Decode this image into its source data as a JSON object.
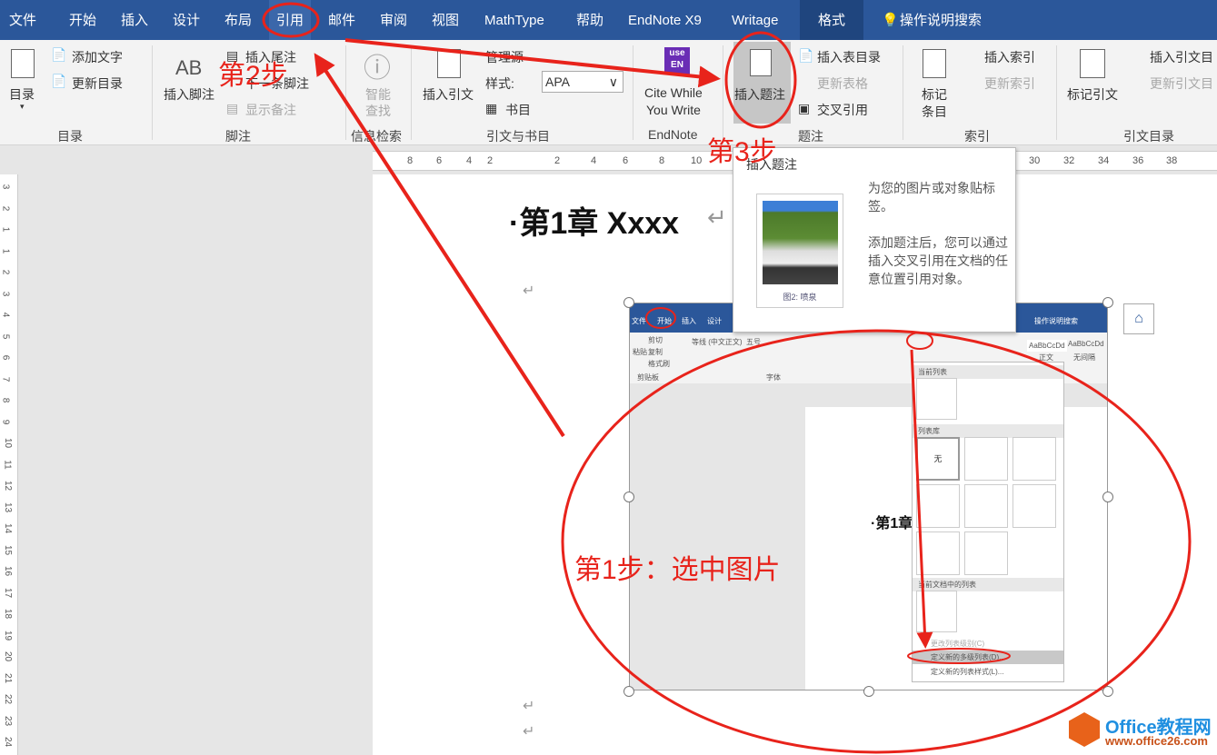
{
  "tabs": [
    "文件",
    "开始",
    "插入",
    "设计",
    "布局",
    "引用",
    "邮件",
    "审阅",
    "视图",
    "MathType",
    "帮助",
    "EndNote X9",
    "Writage",
    "格式"
  ],
  "search_label": "操作说明搜索",
  "ribbon": {
    "toc": {
      "main": "目录",
      "add_text": "添加文字",
      "update": "更新目录",
      "group": "目录"
    },
    "footnote": {
      "insert_footnote": "插入脚注",
      "insert_endnote": "插入尾注",
      "next_footnote": "下一条脚注",
      "show_notes": "显示备注",
      "group": "脚注",
      "ab": "AB"
    },
    "research": {
      "smart_lookup_1": "智能",
      "smart_lookup_2": "查找",
      "group": "信息检索"
    },
    "citations": {
      "insert_citation": "插入引文",
      "manage_sources": "管理源",
      "style_label": "样式:",
      "style_value": "APA",
      "bibliography": "书目",
      "group": "引文与书目"
    },
    "endnote": {
      "cite_1": "Cite While",
      "cite_2": "You Write",
      "group": "EndNote",
      "logo_1": "use",
      "logo_2": "EN"
    },
    "captions": {
      "insert_caption": "插入题注",
      "insert_tof": "插入表目录",
      "update_table": "更新表格",
      "cross_ref": "交叉引用",
      "group": "题注"
    },
    "index": {
      "mark_entry_1": "标记",
      "mark_entry_2": "条目",
      "insert_index": "插入索引",
      "update_index": "更新索引",
      "group": "索引"
    },
    "toa": {
      "mark_citation": "标记引文",
      "insert_toa": "插入引文目",
      "update_toa": "更新引文目",
      "group": "引文目录"
    }
  },
  "ruler": [
    "8",
    "6",
    "4",
    "2",
    "2",
    "4",
    "6",
    "8",
    "10",
    "30",
    "32",
    "34",
    "36",
    "38"
  ],
  "vruler": [
    "3",
    "2",
    "1",
    "1",
    "2",
    "3",
    "4",
    "5",
    "6",
    "7",
    "8",
    "9",
    "10",
    "11",
    "12",
    "13",
    "14",
    "15",
    "16",
    "17",
    "18",
    "19",
    "20",
    "21",
    "22",
    "23",
    "24"
  ],
  "document": {
    "heading": "·第1章 Xxxx",
    "return_mark": "↵"
  },
  "tooltip": {
    "title": "插入题注",
    "desc1": "为您的图片或对象贴标签。",
    "desc2": "添加题注后，您可以通过插入交叉引用在文档的任意位置引用对象。",
    "caption": "图2: 喷泉"
  },
  "inner": {
    "tabs": [
      "文件",
      "开始",
      "插入",
      "设计"
    ],
    "search": "操作说明搜索",
    "cut": "剪切",
    "copy": "复制",
    "painter": "格式刷",
    "paste": "粘贴",
    "clipboard": "剪贴板",
    "font": "等线 (中文正文)",
    "size": "五号",
    "font_group": "字体",
    "style1": "AaBbCcDd",
    "style1_label": "正文",
    "style2": "AaBbCcDd",
    "style2_label": "无间隔",
    "heading": "·第1章",
    "menu": {
      "current": "当前列表",
      "library": "列表库",
      "none": "无",
      "in_doc": "当前文档中的列表",
      "change_level": "更改列表级别(C)",
      "define_new": "定义新的多级列表(D)...",
      "define_style": "定义新的列表样式(L)..."
    }
  },
  "annotations": {
    "step1": "第1步：选中图片",
    "step2": "第2步",
    "step3": "第3步",
    "color": "#e8231b"
  },
  "watermark": {
    "name": "Office教程网",
    "url": "www.office26.com"
  }
}
